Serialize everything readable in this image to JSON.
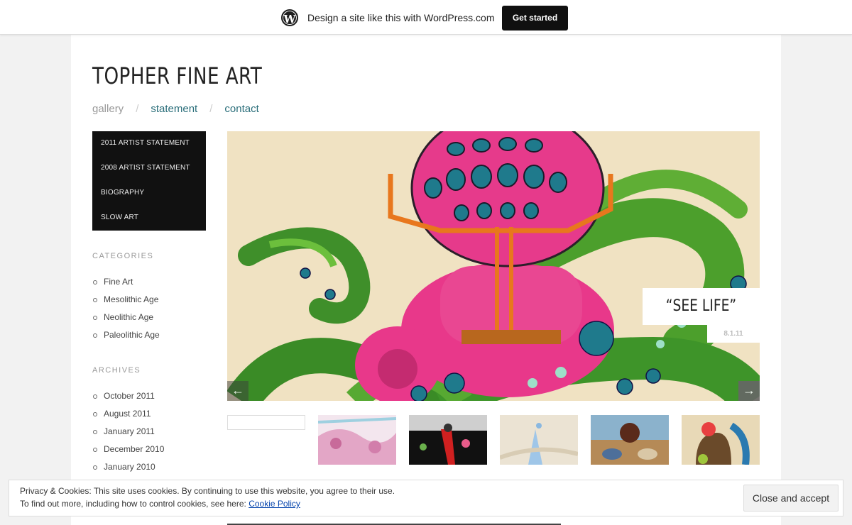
{
  "wpbar": {
    "logo": "W",
    "text": "Design a site like this with WordPress.com",
    "button": "Get started"
  },
  "site": {
    "title": "TOPHER FINE ART",
    "nav": [
      {
        "label": "gallery",
        "current": true
      },
      {
        "label": "statement",
        "current": false
      },
      {
        "label": "contact",
        "current": false
      }
    ],
    "nav_sep": "/"
  },
  "pagemenu": [
    "2011 ARTIST STATEMENT",
    "2008 ARTIST STATEMENT",
    "BIOGRAPHY",
    "SLOW ART"
  ],
  "categories": {
    "title": "CATEGORIES",
    "items": [
      "Fine Art",
      "Mesolithic Age",
      "Neolithic Age",
      "Paleolithic Age"
    ]
  },
  "archives": {
    "title": "ARCHIVES",
    "items": [
      "October 2011",
      "August 2011",
      "January 2011",
      "December 2010",
      "January 2010"
    ]
  },
  "slider": {
    "caption": "“SEE LIFE”",
    "date": "8.1.11",
    "prev": "←",
    "next": "→"
  },
  "cookie": {
    "line1": "Privacy & Cookies: This site uses cookies. By continuing to use this website, you agree to their use.",
    "line2": "To find out more, including how to control cookies, see here:",
    "link": "Cookie Policy",
    "button": "Close and accept"
  }
}
